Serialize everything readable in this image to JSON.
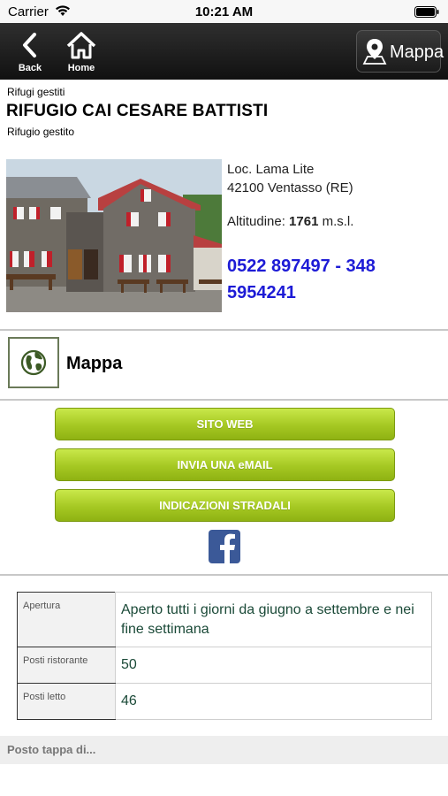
{
  "status_bar": {
    "carrier": "Carrier",
    "time": "10:21 AM"
  },
  "nav": {
    "back_label": "Back",
    "home_label": "Home",
    "map_button_label": "Mappa"
  },
  "header": {
    "category": "Rifugi gestiti",
    "title": "RIFUGIO CAI CESARE BATTISTI",
    "subtitle": "Rifugio gestito"
  },
  "details": {
    "address_line1": "Loc. Lama Lite",
    "address_line2": "42100 Ventasso (RE)",
    "altitude_label": "Altitudine:",
    "altitude_value": "1761",
    "altitude_unit": "m.s.l.",
    "phone": "0522 897497 - 348 5954241"
  },
  "map_row": {
    "label": "Mappa"
  },
  "buttons": {
    "website": "SITO WEB",
    "email": "INVIA UNA eMAIL",
    "directions": "INDICAZIONI STRADALI"
  },
  "info_table": [
    {
      "key": "Apertura",
      "value": "Aperto tutti i giorni da giugno a settembre e nei fine settimana"
    },
    {
      "key": "Posti ristorante",
      "value": "50"
    },
    {
      "key": "Posti letto",
      "value": "46"
    }
  ],
  "section": {
    "label": "Posto tappa di..."
  },
  "colors": {
    "button_green": "#a5c822",
    "phone_blue": "#1d1bd6",
    "nav_dark": "#1b1b1b",
    "facebook_blue": "#3b5998"
  }
}
